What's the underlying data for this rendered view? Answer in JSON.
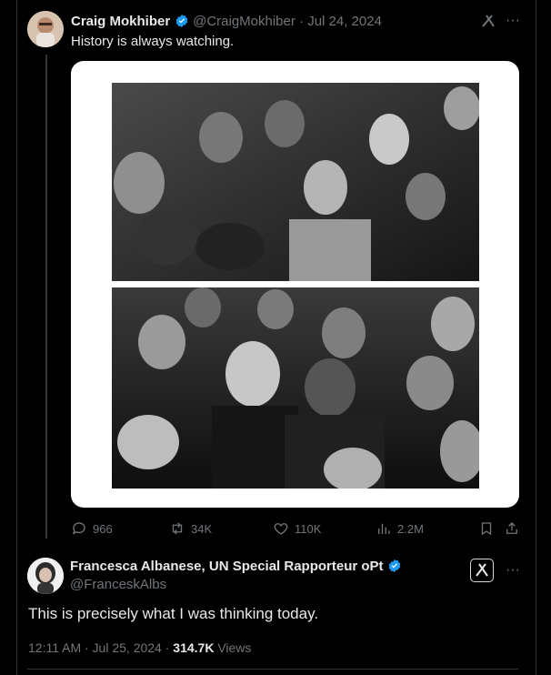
{
  "tweet": {
    "author_name": "Craig Mokhiber",
    "handle_date": "@CraigMokhiber · Jul 24, 2024",
    "text": "History is always watching.",
    "actions": {
      "replies": "966",
      "reposts": "34K",
      "likes": "110K",
      "views": "2.2M"
    }
  },
  "quote": {
    "author_name": "Francesca Albanese, UN Special Rapporteur oPt",
    "handle": "@FranceskAlbs",
    "text": "This is precisely what I was thinking today.",
    "timestamp": "12:11 AM · Jul 25, 2024 · ",
    "views_count": "314.7K",
    "views_label": " Views"
  },
  "icons": [
    "x-grok-icon",
    "more-icon",
    "reply-icon",
    "repost-icon",
    "like-icon",
    "views-icon",
    "bookmark-icon",
    "share-icon",
    "verified-icon"
  ],
  "colors": {
    "background": "#000000",
    "verified": "#1d9bf0",
    "muted": "#71767b",
    "text": "#e7e9ea"
  }
}
